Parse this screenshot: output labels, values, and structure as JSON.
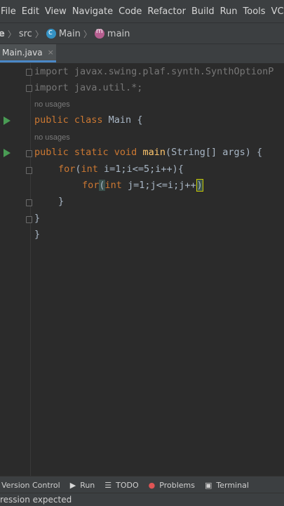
{
  "menu": [
    "File",
    "Edit",
    "View",
    "Navigate",
    "Code",
    "Refactor",
    "Build",
    "Run",
    "Tools",
    "VC"
  ],
  "nav": {
    "project": "e",
    "folder": "src",
    "class_name": "Main",
    "method_name": "main"
  },
  "tab": {
    "label": "Main.java",
    "close": "×"
  },
  "code": {
    "import1": "import javax.swing.plaf.synth.SynthOptionP",
    "import2": "import java.util.*;",
    "usages1": "no usages",
    "class_kw": "public class ",
    "class_name": "Main",
    "class_brace": " {",
    "usages2": "no usages",
    "method_kw": "public static void ",
    "method_name": "main",
    "method_rest": "(String[] args) {",
    "for1_kw": "for",
    "for1_paren": "(",
    "for1_int": "int",
    "for1_rest": " i=1;i<=5;i++){",
    "for2_kw": "for",
    "for2_paren": "(",
    "for2_int": "int",
    "for2_rest": " j=1;j<=i;j++",
    "for2_cursor": ")",
    "close1": "}",
    "close2": "}",
    "close3": "}"
  },
  "bottom_tools": [
    "Version Control",
    "Run",
    "TODO",
    "Problems",
    "Terminal"
  ],
  "status": {
    "message": "ression expected"
  },
  "colors": {
    "keyword": "#cc7832",
    "method": "#ffc66d",
    "run_arrow": "#499c54"
  }
}
